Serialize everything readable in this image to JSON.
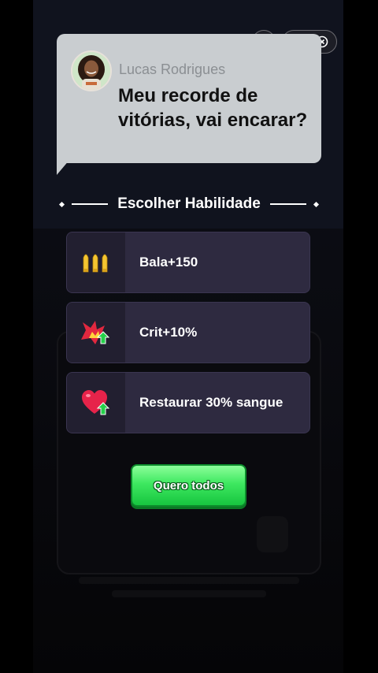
{
  "top_bar": {
    "home_icon": "home-icon",
    "more_icon": "ellipsis-icon",
    "close_icon": "close-circle-icon"
  },
  "challenge": {
    "name": "Lucas Rodrigues",
    "message": "Meu recorde de vitórias, vai encarar?"
  },
  "section_title": "Escolher Habilidade",
  "skills": [
    {
      "label": "Bala+150",
      "icon": "bullets-icon"
    },
    {
      "label": "Crit+10%",
      "icon": "crit-burst-icon"
    },
    {
      "label": "Restaurar 30% sangue",
      "icon": "heart-heal-icon"
    }
  ],
  "cta_label": "Quero todos",
  "colors": {
    "bubble": "#c9cdd0",
    "card": "#2e2a40",
    "card_icon_bg": "#221f30",
    "button_green": "#3ee860"
  }
}
